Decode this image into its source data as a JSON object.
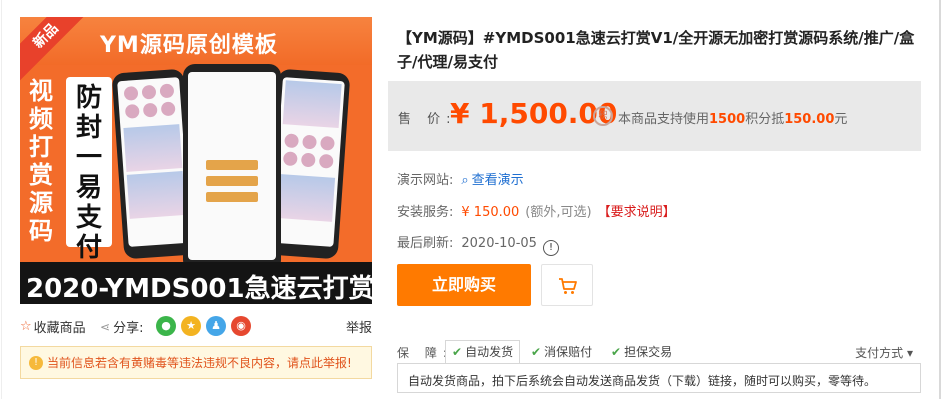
{
  "product_image": {
    "banner_title": "YM源码原创模板",
    "new_badge": "新品",
    "left_text": "视频打赏源码",
    "card_text": "防封一易支付",
    "footer_text": "2020-YMDS001急速云打赏"
  },
  "actions_row": {
    "favorite_label": "收藏商品",
    "share_label": "分享:",
    "share_icons": [
      "wechat-icon",
      "qzone-icon",
      "qq-icon",
      "weibo-icon"
    ],
    "report_label": "举报"
  },
  "notice": {
    "text": "当前信息若含有黄赌毒等违法违规不良内容，请点此举报!"
  },
  "product": {
    "title": "【YM源码】#YMDS001急速云打赏V1/全开源无加密打赏源码系统/推广/盒子/代理/易支付",
    "price_label": "售 价:",
    "price": "¥ 1,500.00",
    "points_prefix": "本商品支持使用",
    "points_amount": "1500",
    "points_middle": "积分抵",
    "points_value": "150.00",
    "points_suffix": "元"
  },
  "info": {
    "demo_label": "演示网站:",
    "demo_link": "查看演示",
    "service_label": "安装服务:",
    "service_price": "¥ 150.00",
    "service_note": "(额外,可选)",
    "service_req": "【要求说明】",
    "refresh_label": "最后刷新:",
    "refresh_date": "2020-10-05"
  },
  "buttons": {
    "buy_label": "立即购买"
  },
  "guarantee": {
    "label": "保 障:",
    "items": [
      "自动发货",
      "消保赔付",
      "担保交易"
    ],
    "pay_method": "支付方式 ▾",
    "description": "自动发货商品，拍下后系统会自动发送商品发货（下载）链接，随时可以购买，零等待。"
  },
  "colors": {
    "accent_orange": "#ff7a00",
    "price_red": "#ff4a00",
    "link_blue": "#1f6fd1",
    "image_orange": "#f36c2a"
  }
}
